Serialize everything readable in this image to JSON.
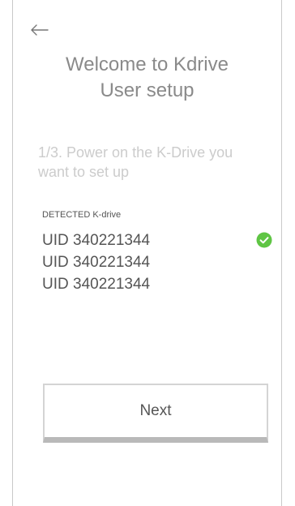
{
  "header": {
    "back_icon": "arrow-left-icon",
    "title_line1": "Welcome to Kdrive",
    "title_line2": "User setup"
  },
  "step": {
    "line1": "1/3. Power on the K-Drive you",
    "line2": "want to set up"
  },
  "detected": {
    "label": "DETECTED K-drive",
    "items": [
      {
        "uid": "UID 340221344",
        "selected": true
      },
      {
        "uid": "UID 340221344",
        "selected": false
      },
      {
        "uid": "UID 340221344",
        "selected": false
      }
    ],
    "check_icon": "check-circle-icon",
    "check_color": "#5fc544"
  },
  "actions": {
    "next_label": "Next"
  }
}
